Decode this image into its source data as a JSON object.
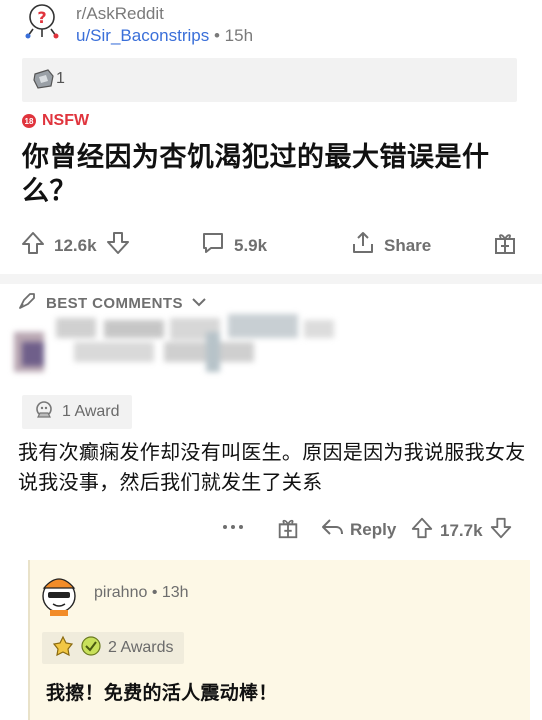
{
  "post": {
    "subreddit": "r/AskReddit",
    "author": "u/Sir_Baconstrips",
    "time": "15h",
    "award_count": "1",
    "nsfw_label": "NSFW",
    "title": "你曾经因为杏饥渴犯过的最大错误是什么？",
    "upvotes": "12.6k",
    "comments": "5.9k",
    "share_label": "Share"
  },
  "comments_header": {
    "sort_label": "BEST COMMENTS"
  },
  "top_comment": {
    "award_label": "1 Award",
    "text": "我有次癫痫发作却没有叫医生。原因是因为我说服我女友说我没事，然后我们就发生了关系",
    "reply_label": "Reply",
    "score": "17.7k"
  },
  "reply": {
    "author": "pirahno",
    "time": "13h",
    "award_label": "2 Awards",
    "text": "我擦！免费的活人震动棒！"
  },
  "colors": {
    "nsfw": "#e0343d",
    "link": "#3a6fd9",
    "reply_bg": "#fdf8e6"
  }
}
